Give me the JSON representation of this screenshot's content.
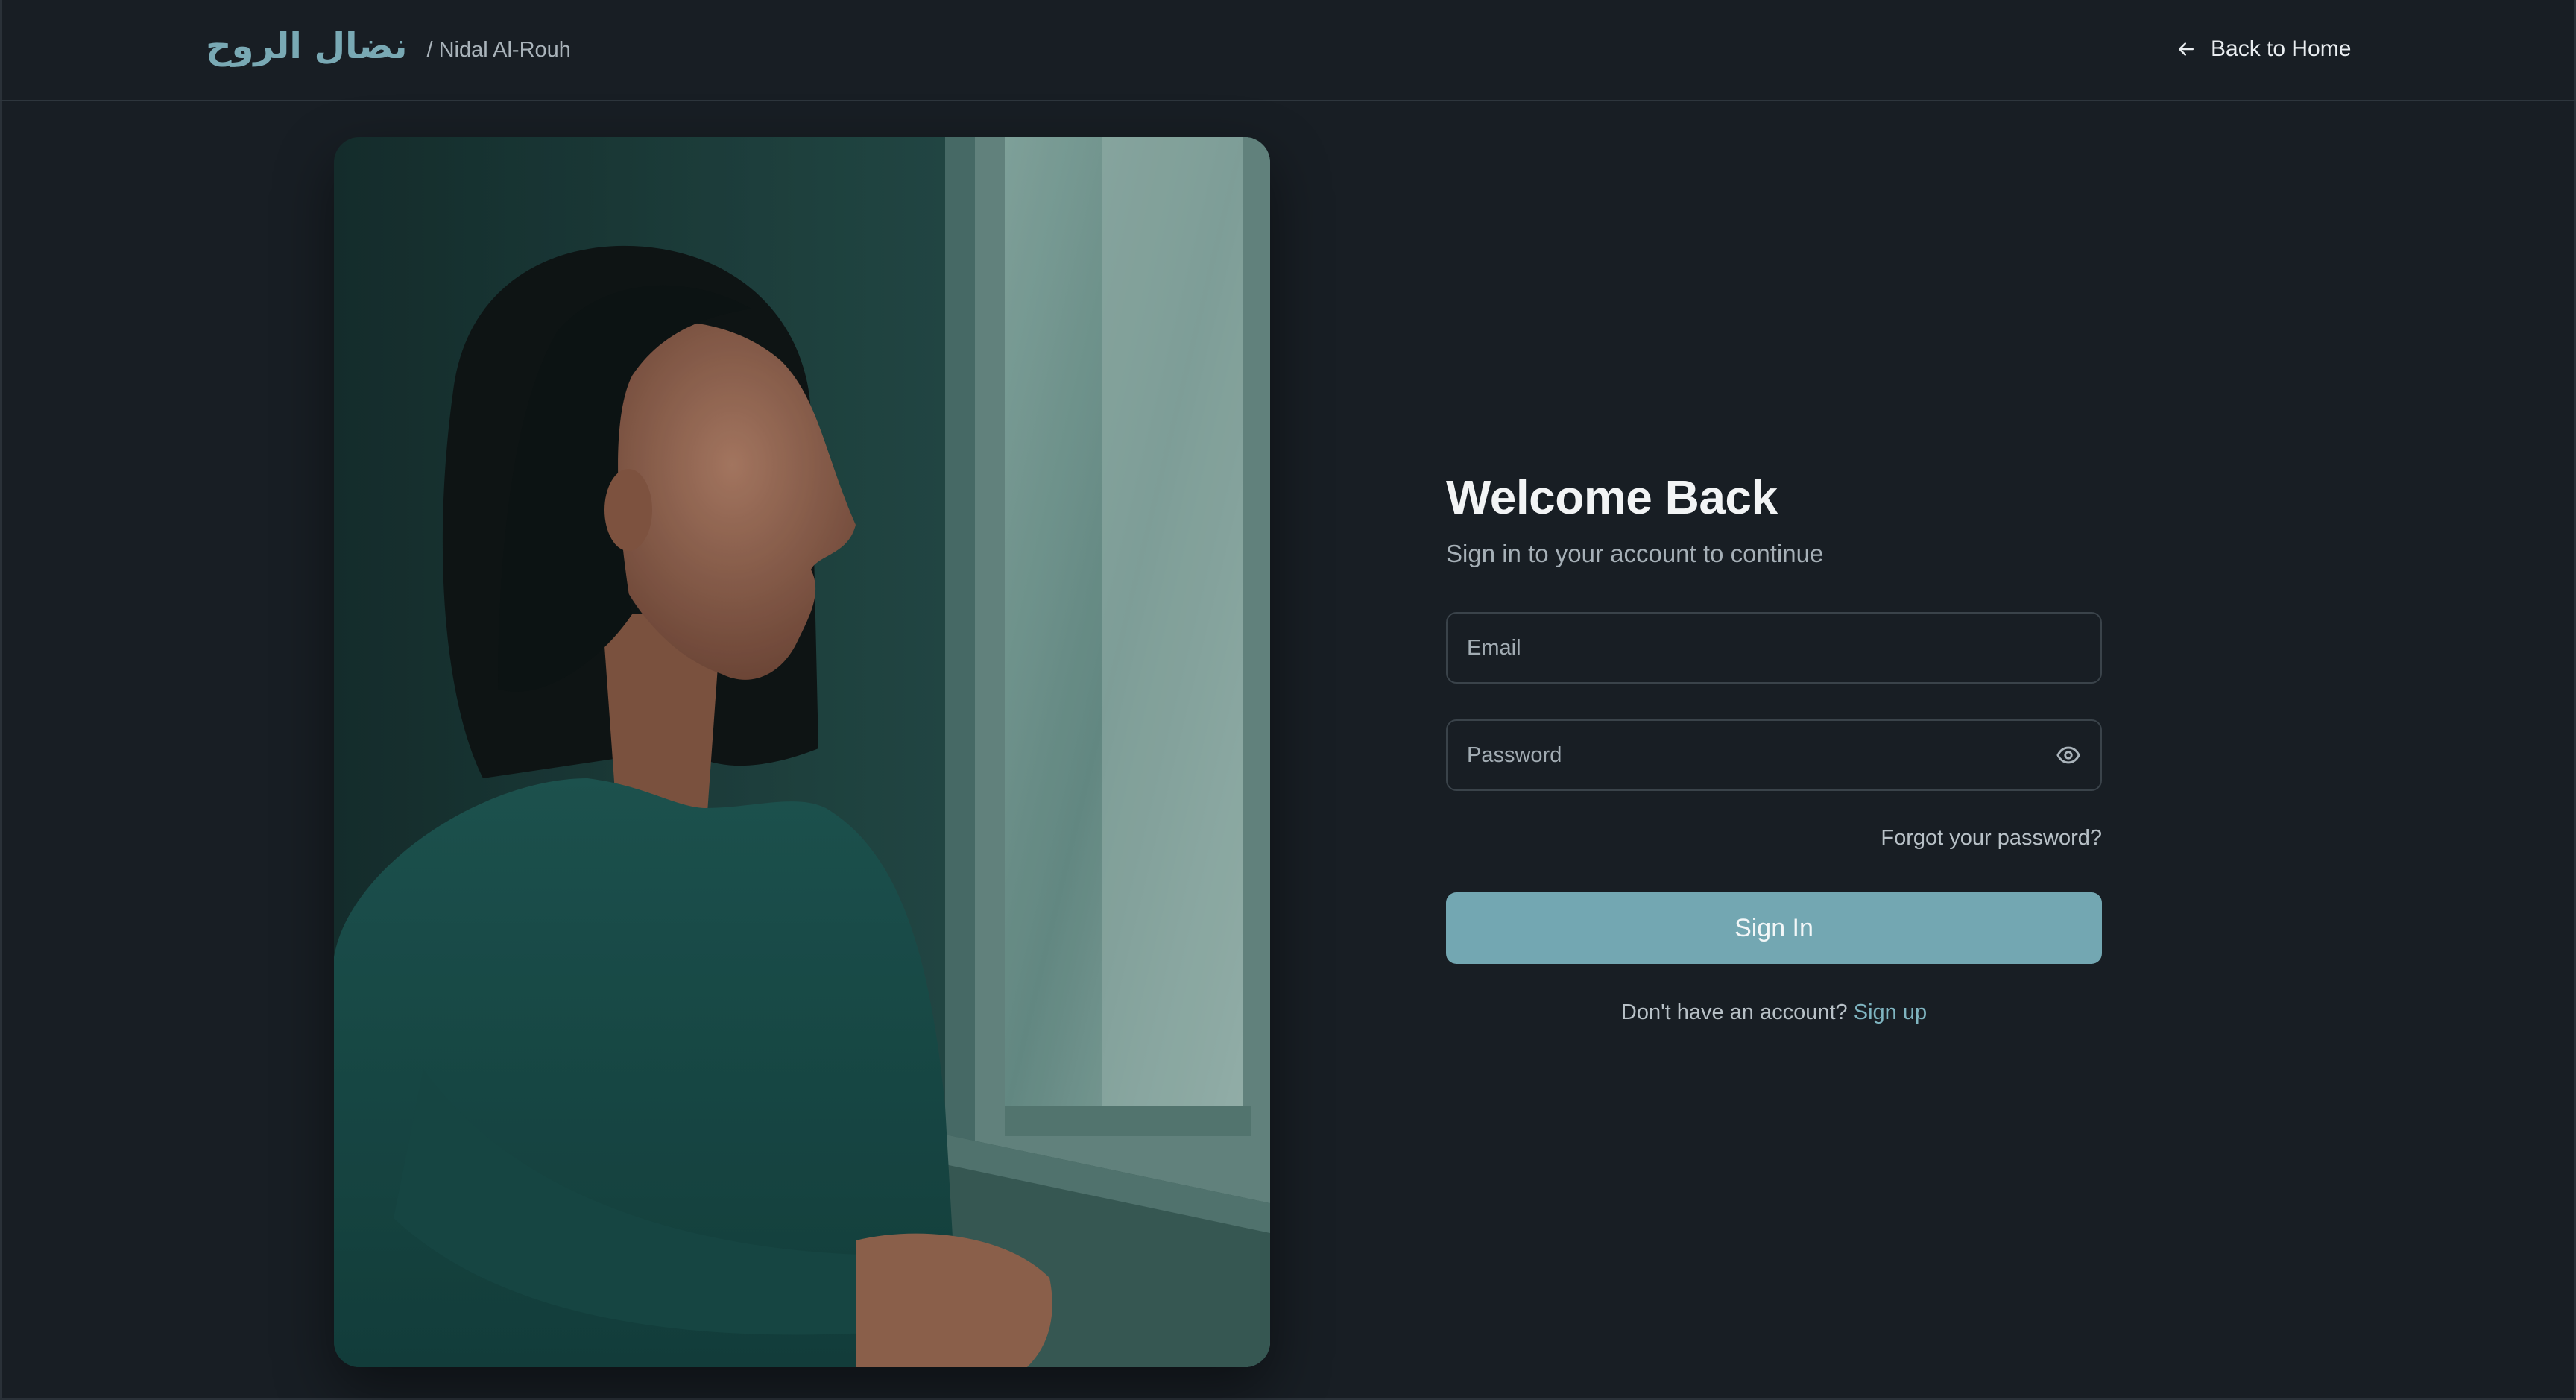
{
  "header": {
    "logo_arabic": "نضال الروح",
    "logo_english": "/ Nidal Al-Rouh",
    "back_label": "Back to Home"
  },
  "icons": {
    "back": "arrow-left-icon",
    "password_toggle": "eye-icon"
  },
  "form": {
    "title": "Welcome Back",
    "subtitle": "Sign in to your account to continue",
    "email_placeholder": "Email",
    "email_value": "",
    "password_placeholder": "Password",
    "password_value": "",
    "forgot_label": "Forgot your password?",
    "submit_label": "Sign In",
    "signup_prompt": "Don't have an account?",
    "signup_link": "Sign up"
  },
  "colors": {
    "background": "#181e24",
    "accent": "#73a7b2",
    "logo": "#79a9b4",
    "link": "#7fb5c1"
  }
}
